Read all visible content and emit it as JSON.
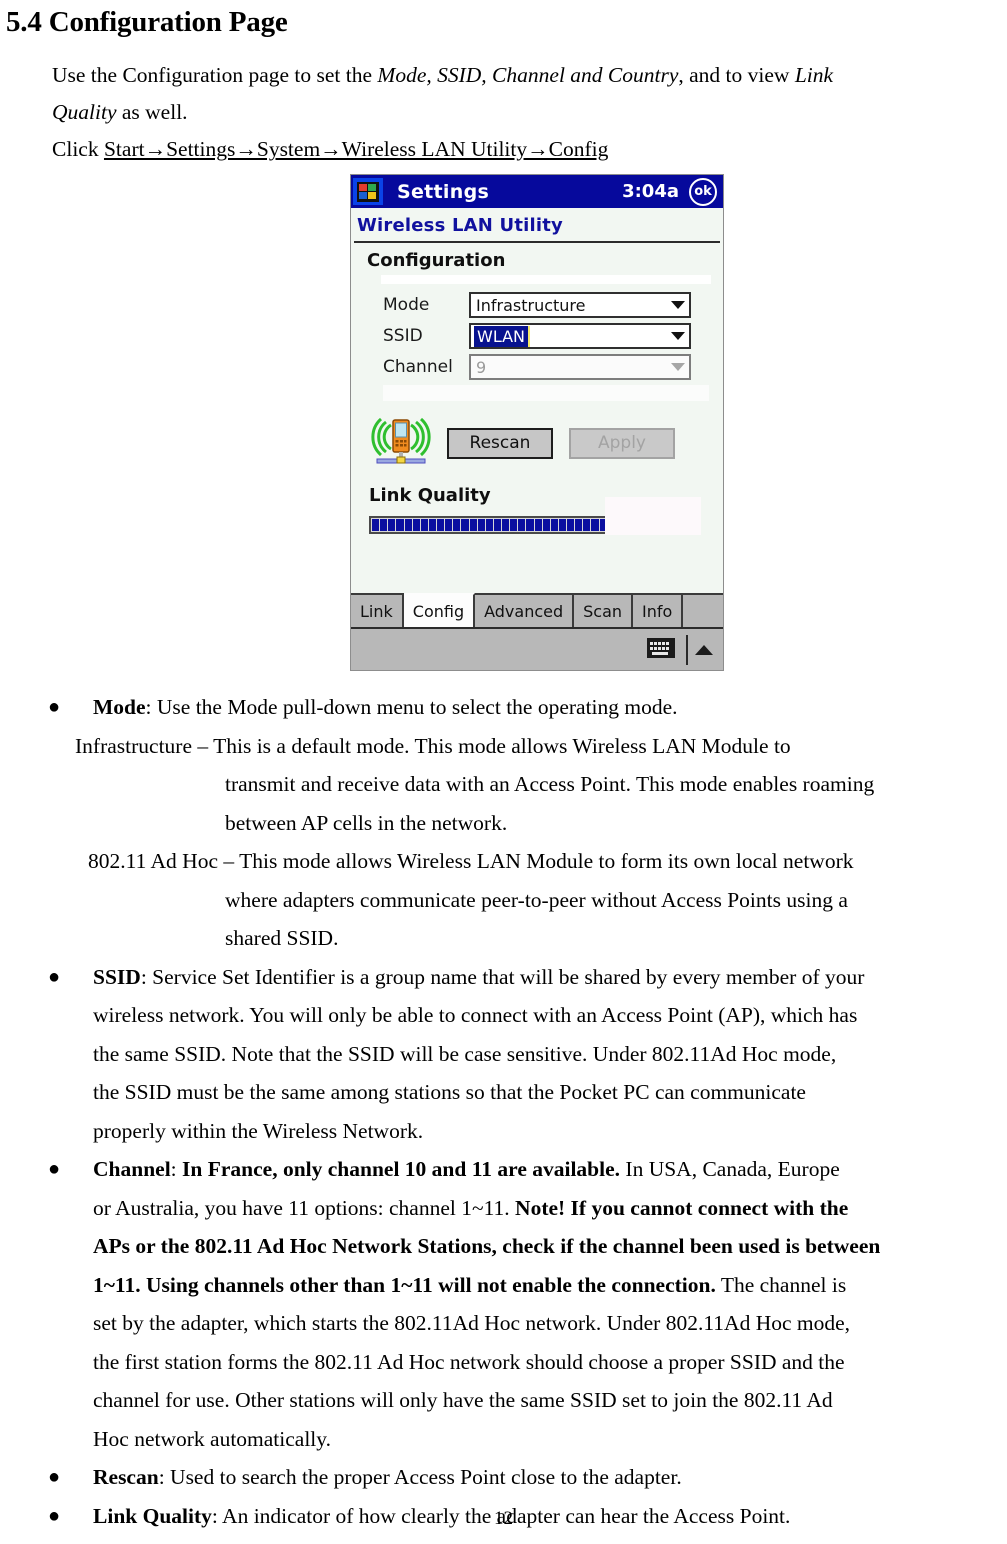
{
  "heading": "5.4 Configuration Page",
  "intro": {
    "line1_a": "Use the Configuration page to set the ",
    "line1_b": "Mode, SSID, Channel and Country",
    "line1_c": ", and to view ",
    "line1_d": "Link",
    "line2_a": "Quality",
    "line2_b": " as well.",
    "line3_a": "Click ",
    "line3_b": "Start→Settings→System→Wireless LAN Utility→Config "
  },
  "device": {
    "titlebar": {
      "icon": "windows-flag-icon",
      "title": "Settings",
      "clock": "3:04a",
      "ok_label": "ok"
    },
    "app_title": "Wireless LAN Utility",
    "section_title": "Configuration",
    "fields": [
      {
        "label": "Mode",
        "value": "Infrastructure",
        "state": "enabled",
        "selected": false
      },
      {
        "label": "SSID",
        "value": "WLAN",
        "state": "enabled",
        "selected": true
      },
      {
        "label": "Channel",
        "value": "9",
        "state": "disabled",
        "selected": false
      }
    ],
    "buttons": {
      "rescan": "Rescan",
      "apply": "Apply"
    },
    "link_quality_label": "Link Quality",
    "link_quality_segments": 40,
    "link_quality_color": "#0b0fa0",
    "tabs": [
      {
        "label": "Link",
        "active": false
      },
      {
        "label": "Config",
        "active": true
      },
      {
        "label": "Advanced",
        "active": false
      },
      {
        "label": "Scan",
        "active": false
      },
      {
        "label": "Info",
        "active": false
      }
    ],
    "taskbar": {
      "keyboard_icon": "keyboard-icon",
      "up_arrow_icon": "triangle-up-icon"
    },
    "wifi_icon": "wireless-pda-icon"
  },
  "bullets": {
    "mode": {
      "term": "Mode",
      "l1_rest": ":    Use the Mode pull-down menu to select the operating mode.",
      "l2": "Infrastructure – This is a default mode.    This mode allows Wireless LAN Module to",
      "l3": "transmit and receive data with an Access Point. This mode enables roaming",
      "l4": "between AP cells in the network.",
      "l5": "802.11 Ad Hoc – This mode allows Wireless LAN Module to form its own local network",
      "l6": "where adapters communicate peer-to-peer without Access Points using a",
      "l7": "shared SSID."
    },
    "ssid": {
      "term": "SSID",
      "l1_rest": ": Service Set Identifier is a group name that will be shared by every member of your",
      "l2": "wireless network.    You will only be able to connect with an Access Point (AP), which has",
      "l3": "the same SSID.    Note that the SSID will be case sensitive.    Under 802.11Ad Hoc mode,",
      "l4": "the SSID must be the same among stations so that the Pocket PC can communicate",
      "l5": "properly within the Wireless Network."
    },
    "channel": {
      "term": "Channel",
      "l1_colon": ":  ",
      "l1_bold": "In France, only channel 10 and 11 are available.",
      "l1_rest": "    In USA, Canada, Europe",
      "l2_plain": "or Australia, you have 11 options: channel 1~11.  ",
      "l2_bold": "  Note! If you cannot connect with the",
      "l3_bold": "APs or the 802.11 Ad Hoc Network Stations, check if the channel been used is between",
      "l4_bold": "1~11.    Using channels other than 1~11 will not enable the connection.",
      "l4_rest": "    The channel is",
      "l5": "set by the adapter, which starts the 802.11Ad Hoc network.    Under 802.11Ad Hoc mode,",
      "l6": "the first station forms the 802.11 Ad Hoc network should choose a proper SSID and the",
      "l7": "channel for use.    Other stations will only have the same SSID set to join the 802.11 Ad",
      "l8": "Hoc network automatically."
    },
    "rescan": {
      "term": "Rescan",
      "rest": ": Used to search the proper Access Point close to the adapter."
    },
    "link_quality": {
      "term": "Link Quality",
      "rest": ":    An indicator of how clearly the adapter can hear the Access Point."
    },
    "bullet_glyph": "●"
  },
  "page_number": "12"
}
